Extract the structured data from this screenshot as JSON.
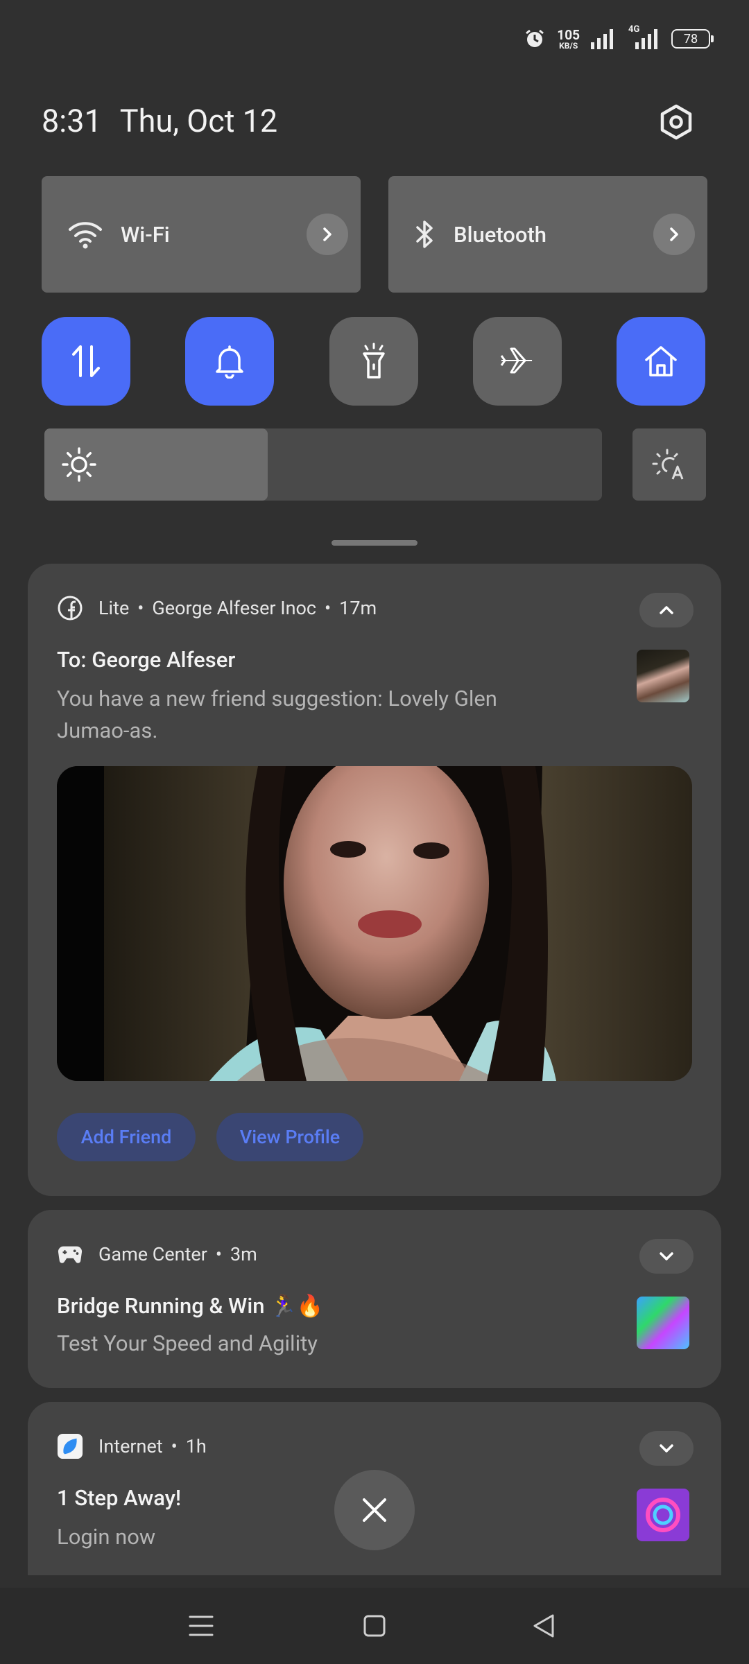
{
  "status_bar": {
    "net_speed_value": "105",
    "net_speed_unit": "KB/S",
    "network_type": "4G",
    "battery": "78",
    "icons": [
      "alarm-icon",
      "signal-icon",
      "signal-4g-icon",
      "battery-icon"
    ]
  },
  "header": {
    "time": "8:31",
    "date": "Thu, Oct 12"
  },
  "quick_settings": {
    "wifi_label": "Wi-Fi",
    "bluetooth_label": "Bluetooth",
    "tiles": [
      {
        "name": "mobile-data",
        "icon": "data-transfer-icon",
        "active": true
      },
      {
        "name": "sound",
        "icon": "bell-icon",
        "active": true
      },
      {
        "name": "flashlight",
        "icon": "flashlight-icon",
        "active": false
      },
      {
        "name": "airplane-mode",
        "icon": "airplane-icon",
        "active": false
      },
      {
        "name": "home",
        "icon": "home-icon",
        "active": true
      }
    ],
    "brightness_level": 0.4,
    "accent_color": "#4a6cf7"
  },
  "notifications": [
    {
      "app": "Lite",
      "account": "George Alfeser Inoc",
      "age": "17m",
      "title": "To: George Alfeser",
      "body": "You have a new friend suggestion: Lovely Glen Jumao-as.",
      "actions": [
        "Add Friend",
        "View Profile"
      ]
    },
    {
      "app": "Game Center",
      "age": "3m",
      "title": "Bridge Running & Win 🏃‍♀️🔥",
      "body": "Test Your Speed and Agility"
    },
    {
      "app": "Internet",
      "age": "1h",
      "title": "1 Step Away!",
      "body": "Login now"
    }
  ]
}
